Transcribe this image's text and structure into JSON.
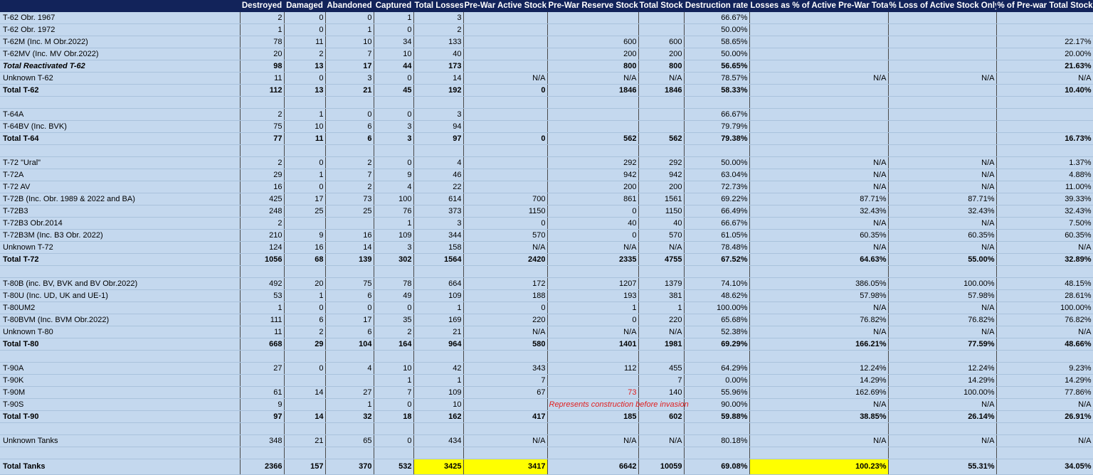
{
  "columns": [
    "",
    "Destroyed",
    "Damaged",
    "Abandoned",
    "Captured",
    "Total Losses",
    "Pre-War Active Stock",
    "Pre-War Reserve Stock",
    "Total Stock",
    "Destruction rate",
    "Losses as % of Active Pre-War Total",
    "% Loss of Active Stock Only",
    "% of Pre-war Total Stock"
  ],
  "rows": [
    {
      "c": [
        "T-62 Obr. 1967",
        "2",
        "0",
        "0",
        "1",
        "3",
        "",
        "",
        "",
        "66.67%",
        "",
        "",
        ""
      ]
    },
    {
      "c": [
        "T-62 Obr. 1972",
        "1",
        "0",
        "1",
        "0",
        "2",
        "",
        "",
        "",
        "50.00%",
        "",
        "",
        ""
      ]
    },
    {
      "sep": true,
      "c": [
        "T-62M (Inc. M Obr.2022)",
        "78",
        "11",
        "10",
        "34",
        "133",
        "",
        "600",
        "600",
        "58.65%",
        "",
        "",
        "22.17%"
      ]
    },
    {
      "c": [
        "T-62MV (Inc. MV Obr.2022)",
        "20",
        "2",
        "7",
        "10",
        "40",
        "",
        "200",
        "200",
        "50.00%",
        "",
        "",
        "20.00%"
      ]
    },
    {
      "bold": true,
      "ital": true,
      "c": [
        "Total Reactivated T-62",
        "98",
        "13",
        "17",
        "44",
        "173",
        "",
        "800",
        "800",
        "56.65%",
        "",
        "",
        "21.63%"
      ]
    },
    {
      "sep": true,
      "c": [
        "Unknown T-62",
        "11",
        "0",
        "3",
        "0",
        "14",
        "N/A",
        "N/A",
        "N/A",
        "78.57%",
        "N/A",
        "N/A",
        "N/A"
      ]
    },
    {
      "bold": true,
      "c": [
        "Total T-62",
        "112",
        "13",
        "21",
        "45",
        "192",
        "0",
        "1846",
        "1846",
        "58.33%",
        "",
        "",
        "10.40%"
      ]
    },
    {
      "c": [
        "",
        "",
        "",
        "",
        "",
        "",
        "",
        "",
        "",
        "",
        "",
        "",
        ""
      ]
    },
    {
      "c": [
        "T-64A",
        "2",
        "1",
        "0",
        "0",
        "3",
        "",
        "",
        "",
        "66.67%",
        "",
        "",
        ""
      ]
    },
    {
      "c": [
        "T-64BV (Inc. BVK)",
        "75",
        "10",
        "6",
        "3",
        "94",
        "",
        "",
        "",
        "79.79%",
        "",
        "",
        ""
      ]
    },
    {
      "bold": true,
      "c": [
        "Total T-64",
        "77",
        "11",
        "6",
        "3",
        "97",
        "0",
        "562",
        "562",
        "79.38%",
        "",
        "",
        "16.73%"
      ]
    },
    {
      "c": [
        "",
        "",
        "",
        "",
        "",
        "",
        "",
        "",
        "",
        "",
        "",
        "",
        ""
      ]
    },
    {
      "c": [
        "T-72 \"Ural\"",
        "2",
        "0",
        "2",
        "0",
        "4",
        "",
        "292",
        "292",
        "50.00%",
        "N/A",
        "N/A",
        "1.37%"
      ]
    },
    {
      "c": [
        "T-72A",
        "29",
        "1",
        "7",
        "9",
        "46",
        "",
        "942",
        "942",
        "63.04%",
        "N/A",
        "N/A",
        "4.88%"
      ]
    },
    {
      "c": [
        "T-72 AV",
        "16",
        "0",
        "2",
        "4",
        "22",
        "",
        "200",
        "200",
        "72.73%",
        "N/A",
        "N/A",
        "11.00%"
      ]
    },
    {
      "c": [
        "T-72B (Inc. Obr. 1989 & 2022 and BA)",
        "425",
        "17",
        "73",
        "100",
        "614",
        "700",
        "861",
        "1561",
        "69.22%",
        "87.71%",
        "87.71%",
        "39.33%"
      ]
    },
    {
      "c": [
        "T-72B3",
        "248",
        "25",
        "25",
        "76",
        "373",
        "1150",
        "0",
        "1150",
        "66.49%",
        "32.43%",
        "32.43%",
        "32.43%"
      ]
    },
    {
      "c": [
        "T-72B3 Obr.2014",
        "2",
        "",
        "",
        "1",
        "3",
        "0",
        "40",
        "40",
        "66.67%",
        "N/A",
        "N/A",
        "7.50%"
      ]
    },
    {
      "c": [
        "T-72B3M (Inc. B3 Obr. 2022)",
        "210",
        "9",
        "16",
        "109",
        "344",
        "570",
        "0",
        "570",
        "61.05%",
        "60.35%",
        "60.35%",
        "60.35%"
      ]
    },
    {
      "c": [
        "Unknown T-72",
        "124",
        "16",
        "14",
        "3",
        "158",
        "N/A",
        "N/A",
        "N/A",
        "78.48%",
        "N/A",
        "N/A",
        "N/A"
      ]
    },
    {
      "bold": true,
      "c": [
        "Total T-72",
        "1056",
        "68",
        "139",
        "302",
        "1564",
        "2420",
        "2335",
        "4755",
        "67.52%",
        "64.63%",
        "55.00%",
        "32.89%"
      ]
    },
    {
      "c": [
        "",
        "",
        "",
        "",
        "",
        "",
        "",
        "",
        "",
        "",
        "",
        "",
        ""
      ]
    },
    {
      "c": [
        "T-80B (inc. BV, BVK and BV Obr.2022)",
        "492",
        "20",
        "75",
        "78",
        "664",
        "172",
        "1207",
        "1379",
        "74.10%",
        "386.05%",
        "100.00%",
        "48.15%"
      ]
    },
    {
      "c": [
        "T-80U (Inc. UD, UK and UE-1)",
        "53",
        "1",
        "6",
        "49",
        "109",
        "188",
        "193",
        "381",
        "48.62%",
        "57.98%",
        "57.98%",
        "28.61%"
      ]
    },
    {
      "c": [
        "T-80UM2",
        "1",
        "0",
        "0",
        "0",
        "1",
        "0",
        "1",
        "1",
        "100.00%",
        "N/A",
        "N/A",
        "100.00%"
      ]
    },
    {
      "c": [
        "T-80BVM (Inc. BVM Obr.2022)",
        "111",
        "6",
        "17",
        "35",
        "169",
        "220",
        "0",
        "220",
        "65.68%",
        "76.82%",
        "76.82%",
        "76.82%"
      ]
    },
    {
      "c": [
        "Unknown T-80",
        "11",
        "2",
        "6",
        "2",
        "21",
        "N/A",
        "N/A",
        "N/A",
        "52.38%",
        "N/A",
        "N/A",
        "N/A"
      ]
    },
    {
      "bold": true,
      "c": [
        "Total T-80",
        "668",
        "29",
        "104",
        "164",
        "964",
        "580",
        "1401",
        "1981",
        "69.29%",
        "166.21%",
        "77.59%",
        "48.66%"
      ]
    },
    {
      "c": [
        "",
        "",
        "",
        "",
        "",
        "",
        "",
        "",
        "",
        "",
        "",
        "",
        ""
      ]
    },
    {
      "c": [
        "T-90A",
        "27",
        "0",
        "4",
        "10",
        "42",
        "343",
        "112",
        "455",
        "64.29%",
        "12.24%",
        "12.24%",
        "9.23%"
      ]
    },
    {
      "c": [
        "T-90K",
        "",
        "",
        "",
        "1",
        "1",
        "7",
        "",
        "7",
        "0.00%",
        "14.29%",
        "14.29%",
        "14.29%"
      ]
    },
    {
      "red7": true,
      "c": [
        "T-90M",
        "61",
        "14",
        "27",
        "7",
        "109",
        "67",
        "73",
        "140",
        "55.96%",
        "162.69%",
        "100.00%",
        "77.86%"
      ]
    },
    {
      "note": "Represents construction before invasion",
      "c": [
        "T-90S",
        "9",
        "",
        "1",
        "0",
        "10",
        "",
        "",
        "",
        "90.00%",
        "N/A",
        "N/A",
        "N/A"
      ]
    },
    {
      "bold": true,
      "c": [
        "Total T-90",
        "97",
        "14",
        "32",
        "18",
        "162",
        "417",
        "185",
        "602",
        "59.88%",
        "38.85%",
        "26.14%",
        "26.91%"
      ]
    },
    {
      "c": [
        "",
        "",
        "",
        "",
        "",
        "",
        "",
        "",
        "",
        "",
        "",
        "",
        ""
      ]
    },
    {
      "c": [
        "Unknown Tanks",
        "348",
        "21",
        "65",
        "0",
        "434",
        "N/A",
        "N/A",
        "N/A",
        "80.18%",
        "N/A",
        "N/A",
        "N/A"
      ]
    },
    {
      "c": [
        "",
        "",
        "",
        "",
        "",
        "",
        "",
        "",
        "",
        "",
        "",
        "",
        ""
      ]
    },
    {
      "bold": true,
      "final": true,
      "c": [
        "Total Tanks",
        "2366",
        "157",
        "370",
        "532",
        "3425",
        "3417",
        "6642",
        "10059",
        "69.08%",
        "100.23%",
        "55.31%",
        "34.05%"
      ]
    }
  ],
  "colors": {
    "header_bg": "#12235a",
    "cell_bg": "#c4d8ee",
    "highlight": "#ffff00",
    "note_red": "#e02020"
  }
}
